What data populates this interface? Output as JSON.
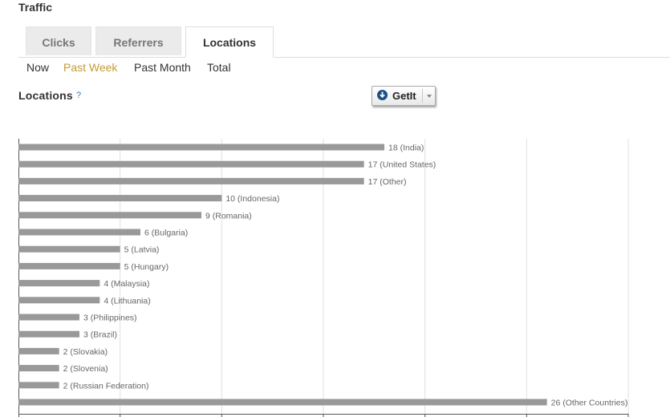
{
  "page": {
    "title": "Traffic"
  },
  "tabs": [
    {
      "label": "Clicks",
      "active": false
    },
    {
      "label": "Referrers",
      "active": false
    },
    {
      "label": "Locations",
      "active": true
    }
  ],
  "time_filters": [
    {
      "label": "Now",
      "active": false
    },
    {
      "label": "Past Week",
      "active": true
    },
    {
      "label": "Past Month",
      "active": false
    },
    {
      "label": "Total",
      "active": false
    }
  ],
  "section": {
    "label": "Locations",
    "help": "?"
  },
  "getit_button": {
    "label": "GetIt",
    "icon": "download-icon",
    "menu_icon": "chevron-down-icon"
  },
  "colors": {
    "bar": "#999999",
    "active_filter": "#c59b33",
    "gridline": "#e0e0e0",
    "axis": "#555555"
  },
  "chart_data": {
    "type": "bar",
    "orientation": "horizontal",
    "categories": [
      "India",
      "United States",
      "Other",
      "Indonesia",
      "Romania",
      "Bulgaria",
      "Latvia",
      "Hungary",
      "Malaysia",
      "Lithuania",
      "Philippines",
      "Brazil",
      "Slovakia",
      "Slovenia",
      "Russian Federation",
      "Other Countries"
    ],
    "values": [
      18,
      17,
      17,
      10,
      9,
      6,
      5,
      5,
      4,
      4,
      3,
      3,
      2,
      2,
      2,
      26
    ],
    "labels": [
      "18 (India)",
      "17 (United States)",
      "17 (Other)",
      "10 (Indonesia)",
      "9 (Romania)",
      "6 (Bulgaria)",
      "5 (Latvia)",
      "5 (Hungary)",
      "4 (Malaysia)",
      "4 (Lithuania)",
      "3 (Philippines)",
      "3 (Brazil)",
      "2 (Slovakia)",
      "2 (Slovenia)",
      "2 (Russian Federation)",
      "26 (Other Countries)"
    ],
    "xlim": [
      0,
      30
    ],
    "grid": true,
    "gridline_values": [
      5,
      10,
      15,
      20,
      25,
      30
    ]
  }
}
